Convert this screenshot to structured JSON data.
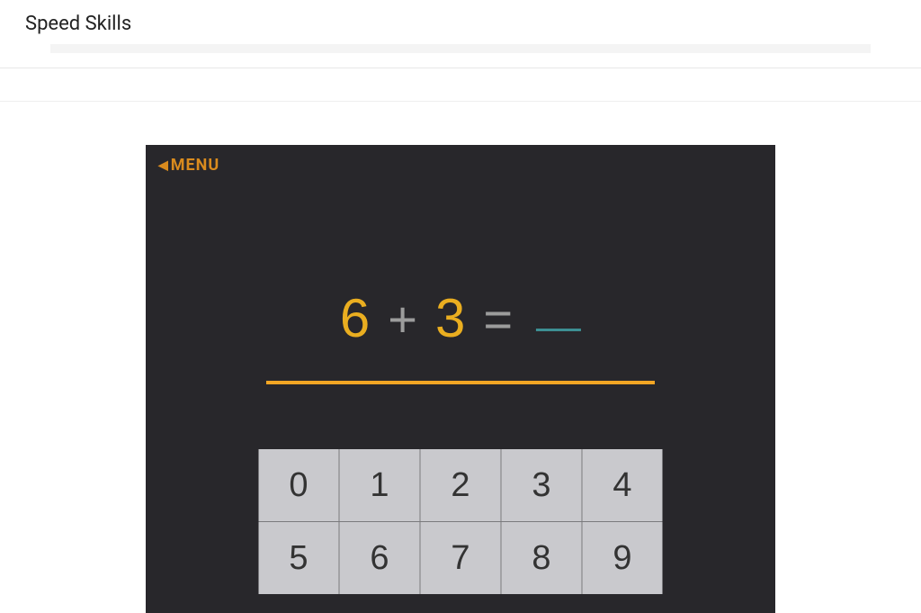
{
  "header": {
    "title": "Speed Skills"
  },
  "menu": {
    "label": "MENU"
  },
  "equation": {
    "operand1": "6",
    "operator": "+",
    "operand2": "3",
    "equals": "="
  },
  "keypad": {
    "keys": [
      "0",
      "1",
      "2",
      "3",
      "4",
      "5",
      "6",
      "7",
      "8",
      "9"
    ]
  },
  "colors": {
    "accent": "#f3a624",
    "menu_text": "#d98b1e",
    "operand": "#eaae20",
    "blank_underline": "#3d8f93",
    "canvas_bg": "#28272b",
    "key_bg": "#c9c9cd"
  }
}
